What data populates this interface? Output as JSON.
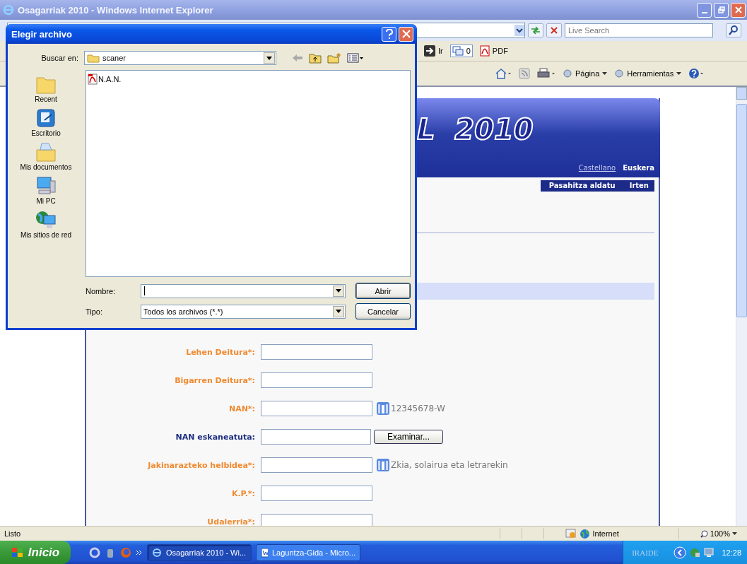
{
  "window": {
    "title": "Osagarriak 2010 - Windows Internet Explorer"
  },
  "address_bar": {
    "search_placeholder": "Live Search"
  },
  "links_bar": {
    "go_label": "Ir",
    "counter": "0",
    "pdf_label": "PDF"
  },
  "command_bar": {
    "items": [
      {
        "kind": "home"
      },
      {
        "kind": "feeds"
      },
      {
        "kind": "print"
      },
      {
        "kind": "menu",
        "label": "Página"
      },
      {
        "kind": "menu",
        "label": "Herramientas"
      },
      {
        "kind": "help"
      }
    ]
  },
  "page": {
    "header_title": "L  2010",
    "languages": [
      {
        "label": "Castellano",
        "selected": false
      },
      {
        "label": "Euskera",
        "selected": true
      }
    ],
    "nav": [
      "Pasahitza aldatu",
      "Irten"
    ],
    "form": [
      {
        "label": "Lehen Deitura*:",
        "required": true,
        "kind": "text"
      },
      {
        "label": "Bigarren Deitura*:",
        "required": true,
        "kind": "text"
      },
      {
        "label": "NAN*:",
        "required": true,
        "kind": "text",
        "hint": "12345678-W"
      },
      {
        "label": "NAN eskaneatuta:",
        "required": false,
        "kind": "file",
        "button": "Examinar..."
      },
      {
        "label": "Jakinarazteko helbidea*:",
        "required": true,
        "kind": "text",
        "hint": "Zkia, solairua eta letrarekin"
      },
      {
        "label": "K.P.*:",
        "required": true,
        "kind": "text"
      },
      {
        "label": "Udalerria*:",
        "required": true,
        "kind": "text"
      }
    ]
  },
  "dialog": {
    "title": "Elegir archivo",
    "look_in_label": "Buscar en:",
    "look_in_value": "scaner",
    "places": [
      {
        "label": "Recent",
        "kind": "recent"
      },
      {
        "label": "Escritorio",
        "kind": "desktop"
      },
      {
        "label": "Mis documentos",
        "kind": "documents"
      },
      {
        "label": "Mi PC",
        "kind": "computer"
      },
      {
        "label": "Mis sitios de red",
        "kind": "network"
      }
    ],
    "files": [
      {
        "name": "N.A.N.",
        "kind": "pdf"
      }
    ],
    "file_name_label": "Nombre:",
    "file_type_label": "Tipo:",
    "file_type_value": "Todos los archivos (*.*)",
    "buttons": [
      "Abrir",
      "Cancelar"
    ]
  },
  "status_bar": {
    "text": "Listo",
    "zone": "Internet",
    "zoom": "100%"
  },
  "taskbar": {
    "start": "Inicio",
    "tasks": [
      {
        "label": "Osagarriak 2010 - Wi...",
        "kind": "browser",
        "selected": true
      },
      {
        "label": "Laguntza-Gida - Micro...",
        "kind": "document",
        "selected": false
      }
    ],
    "user": "IRAIDE",
    "clock": "12:28"
  }
}
